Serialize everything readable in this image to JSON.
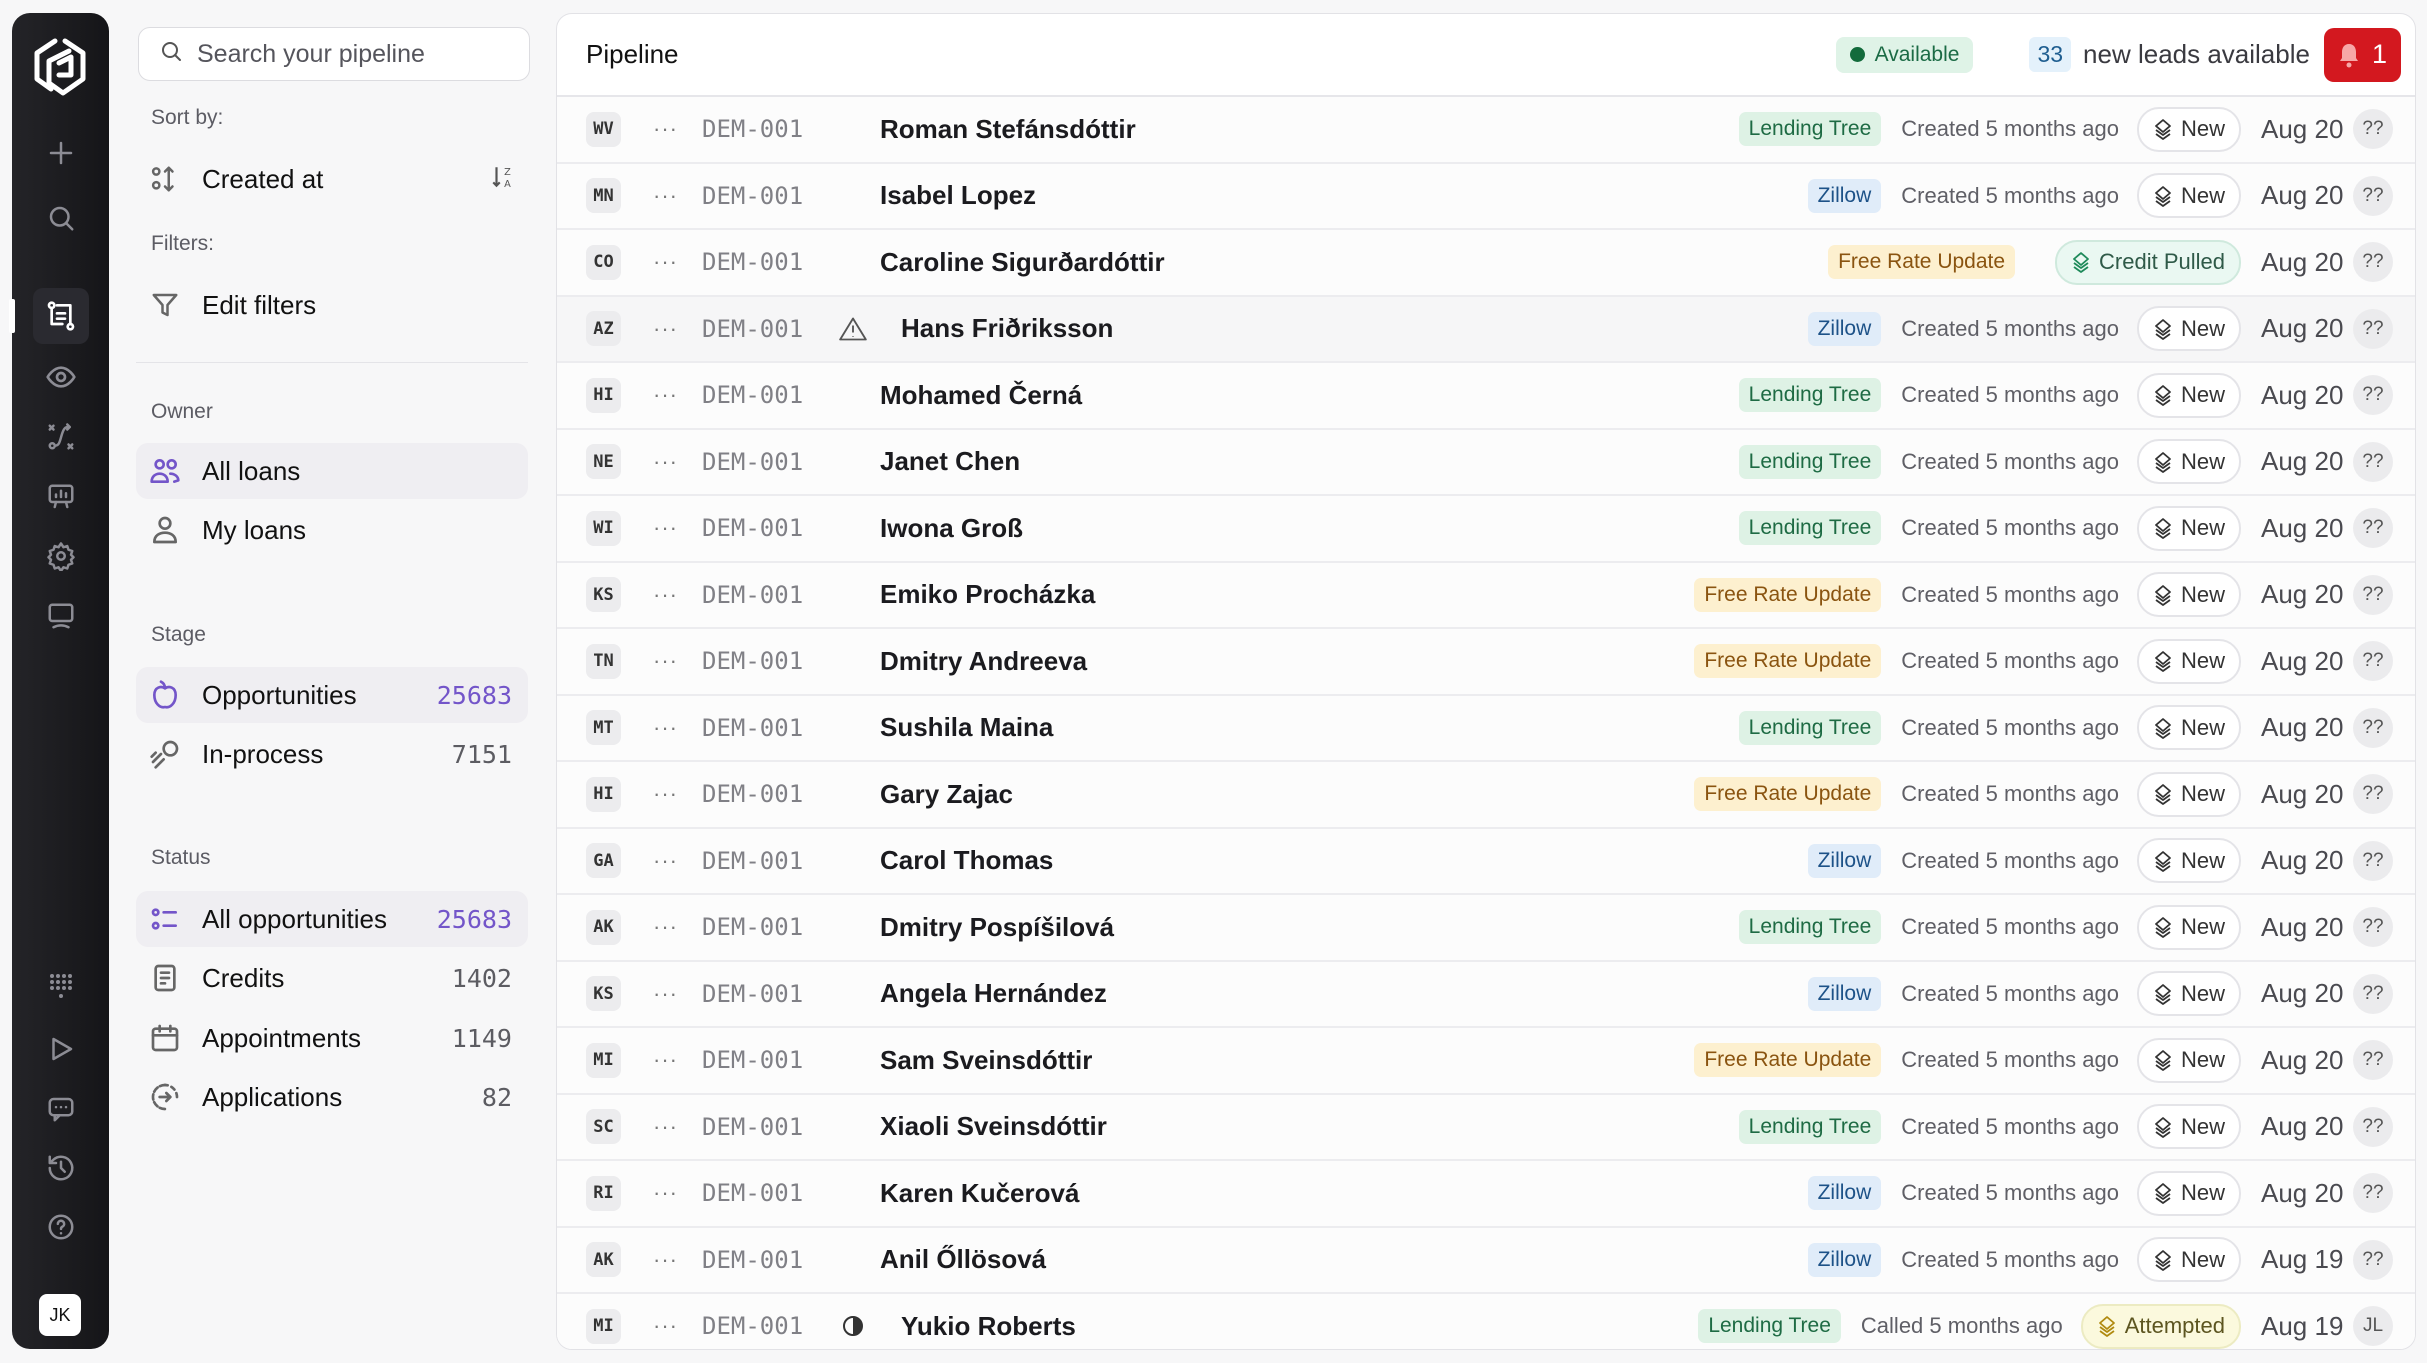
{
  "rail": {
    "icons": [
      "logo-icon",
      "plus-icon",
      "search-icon",
      "pipeline-icon",
      "eye-icon",
      "route-icon",
      "presentation-icon",
      "gear-icon",
      "monitor-icon",
      "dialpad-icon",
      "play-icon",
      "chat-icon",
      "history-icon",
      "help-icon"
    ],
    "avatar": "JK"
  },
  "sidebar": {
    "search_placeholder": "Search your pipeline",
    "sort_label": "Sort by:",
    "sort_value": "Created at",
    "filters_label": "Filters:",
    "edit_filters": "Edit filters",
    "owner_label": "Owner",
    "owner_items": [
      {
        "label": "All loans"
      },
      {
        "label": "My loans"
      }
    ],
    "stage_label": "Stage",
    "stage_items": [
      {
        "label": "Opportunities",
        "count": "25683"
      },
      {
        "label": "In-process",
        "count": "7151"
      }
    ],
    "status_label": "Status",
    "status_items": [
      {
        "label": "All opportunities",
        "count": "25683"
      },
      {
        "label": "Credits",
        "count": "1402"
      },
      {
        "label": "Appointments",
        "count": "1149"
      },
      {
        "label": "Applications",
        "count": "82"
      }
    ]
  },
  "header": {
    "title": "Pipeline",
    "availability": "Available",
    "leads_count": "33",
    "leads_text": "new leads available",
    "notifications": "1"
  },
  "colors": {
    "accent": "#7355c9",
    "alert": "#d3181f",
    "available": "#136b3c"
  },
  "rows": [
    {
      "initials": "WV",
      "code": "DEM-001",
      "flag": "",
      "name": "Roman Stefánsdóttir",
      "source": "Lending Tree",
      "src": "lt",
      "activity": "Created 5 months ago",
      "stage": "New",
      "stype": "new",
      "date": "Aug 20",
      "owner": "??"
    },
    {
      "initials": "MN",
      "code": "DEM-001",
      "flag": "",
      "name": "Isabel Lopez",
      "source": "Zillow",
      "src": "zl",
      "activity": "Created 5 months ago",
      "stage": "New",
      "stype": "new",
      "date": "Aug 20",
      "owner": "??"
    },
    {
      "initials": "CO",
      "code": "DEM-001",
      "flag": "",
      "name": "Caroline Sigurðardóttir",
      "source": "Free Rate Update",
      "src": "fr",
      "activity": "",
      "stage": "Credit Pulled",
      "stype": "cp",
      "date": "Aug 20",
      "owner": "??"
    },
    {
      "initials": "AZ",
      "code": "DEM-001",
      "flag": "warning",
      "name": "Hans Friðriksson",
      "source": "Zillow",
      "src": "zl",
      "activity": "Created 5 months ago",
      "stage": "New",
      "stype": "new",
      "date": "Aug 20",
      "owner": "??"
    },
    {
      "initials": "HI",
      "code": "DEM-001",
      "flag": "",
      "name": "Mohamed Černá",
      "source": "Lending Tree",
      "src": "lt",
      "activity": "Created 5 months ago",
      "stage": "New",
      "stype": "new",
      "date": "Aug 20",
      "owner": "??"
    },
    {
      "initials": "NE",
      "code": "DEM-001",
      "flag": "",
      "name": "Janet Chen",
      "source": "Lending Tree",
      "src": "lt",
      "activity": "Created 5 months ago",
      "stage": "New",
      "stype": "new",
      "date": "Aug 20",
      "owner": "??"
    },
    {
      "initials": "WI",
      "code": "DEM-001",
      "flag": "",
      "name": "Iwona Groß",
      "source": "Lending Tree",
      "src": "lt",
      "activity": "Created 5 months ago",
      "stage": "New",
      "stype": "new",
      "date": "Aug 20",
      "owner": "??"
    },
    {
      "initials": "KS",
      "code": "DEM-001",
      "flag": "",
      "name": "Emiko Procházka",
      "source": "Free Rate Update",
      "src": "fr",
      "activity": "Created 5 months ago",
      "stage": "New",
      "stype": "new",
      "date": "Aug 20",
      "owner": "??"
    },
    {
      "initials": "TN",
      "code": "DEM-001",
      "flag": "",
      "name": "Dmitry Andreeva",
      "source": "Free Rate Update",
      "src": "fr",
      "activity": "Created 5 months ago",
      "stage": "New",
      "stype": "new",
      "date": "Aug 20",
      "owner": "??"
    },
    {
      "initials": "MT",
      "code": "DEM-001",
      "flag": "",
      "name": "Sushila Maina",
      "source": "Lending Tree",
      "src": "lt",
      "activity": "Created 5 months ago",
      "stage": "New",
      "stype": "new",
      "date": "Aug 20",
      "owner": "??"
    },
    {
      "initials": "HI",
      "code": "DEM-001",
      "flag": "",
      "name": "Gary Zajac",
      "source": "Free Rate Update",
      "src": "fr",
      "activity": "Created 5 months ago",
      "stage": "New",
      "stype": "new",
      "date": "Aug 20",
      "owner": "??"
    },
    {
      "initials": "GA",
      "code": "DEM-001",
      "flag": "",
      "name": "Carol Thomas",
      "source": "Zillow",
      "src": "zl",
      "activity": "Created 5 months ago",
      "stage": "New",
      "stype": "new",
      "date": "Aug 20",
      "owner": "??"
    },
    {
      "initials": "AK",
      "code": "DEM-001",
      "flag": "",
      "name": "Dmitry Pospíšilová",
      "source": "Lending Tree",
      "src": "lt",
      "activity": "Created 5 months ago",
      "stage": "New",
      "stype": "new",
      "date": "Aug 20",
      "owner": "??"
    },
    {
      "initials": "KS",
      "code": "DEM-001",
      "flag": "",
      "name": "Angela Hernández",
      "source": "Zillow",
      "src": "zl",
      "activity": "Created 5 months ago",
      "stage": "New",
      "stype": "new",
      "date": "Aug 20",
      "owner": "??"
    },
    {
      "initials": "MI",
      "code": "DEM-001",
      "flag": "",
      "name": "Sam Sveinsdóttir",
      "source": "Free Rate Update",
      "src": "fr",
      "activity": "Created 5 months ago",
      "stage": "New",
      "stype": "new",
      "date": "Aug 20",
      "owner": "??"
    },
    {
      "initials": "SC",
      "code": "DEM-001",
      "flag": "",
      "name": "Xiaoli Sveinsdóttir",
      "source": "Lending Tree",
      "src": "lt",
      "activity": "Created 5 months ago",
      "stage": "New",
      "stype": "new",
      "date": "Aug 20",
      "owner": "??"
    },
    {
      "initials": "RI",
      "code": "DEM-001",
      "flag": "",
      "name": "Karen Kučerová",
      "source": "Zillow",
      "src": "zl",
      "activity": "Created 5 months ago",
      "stage": "New",
      "stype": "new",
      "date": "Aug 20",
      "owner": "??"
    },
    {
      "initials": "AK",
      "code": "DEM-001",
      "flag": "",
      "name": "Anil Őllösová",
      "source": "Zillow",
      "src": "zl",
      "activity": "Created 5 months ago",
      "stage": "New",
      "stype": "new",
      "date": "Aug 19",
      "owner": "??"
    },
    {
      "initials": "MI",
      "code": "DEM-001",
      "flag": "half-circle",
      "name": "Yukio Roberts",
      "source": "Lending Tree",
      "src": "lt",
      "activity": "Called 5 months ago",
      "stage": "Attempted",
      "stype": "at",
      "date": "Aug 19",
      "owner": "JL"
    }
  ]
}
